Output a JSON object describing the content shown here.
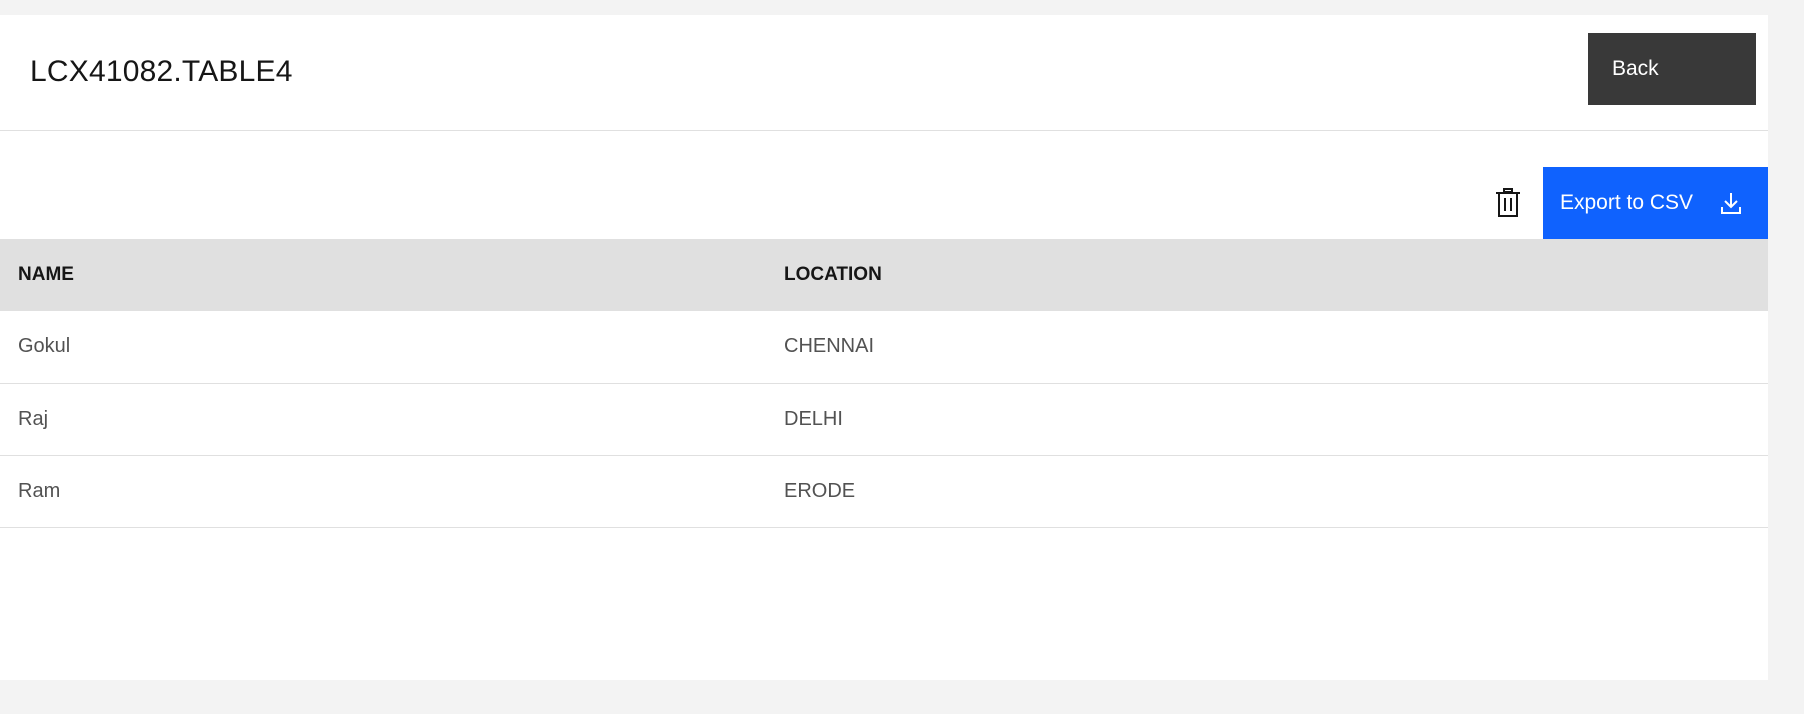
{
  "header": {
    "title": "LCX41082.TABLE4",
    "back_label": "Back"
  },
  "toolbar": {
    "delete_icon": "trash-icon",
    "export_label": "Export to CSV",
    "export_icon": "download-icon"
  },
  "table": {
    "columns": [
      "NAME",
      "LOCATION"
    ],
    "rows": [
      {
        "name": "Gokul",
        "location": "CHENNAI"
      },
      {
        "name": "Raj",
        "location": "DELHI"
      },
      {
        "name": "Ram",
        "location": "ERODE"
      }
    ]
  },
  "colors": {
    "primary": "#0f62fe",
    "secondary": "#393939",
    "header_bg": "#e0e0e0",
    "page_bg": "#f3f3f3"
  }
}
